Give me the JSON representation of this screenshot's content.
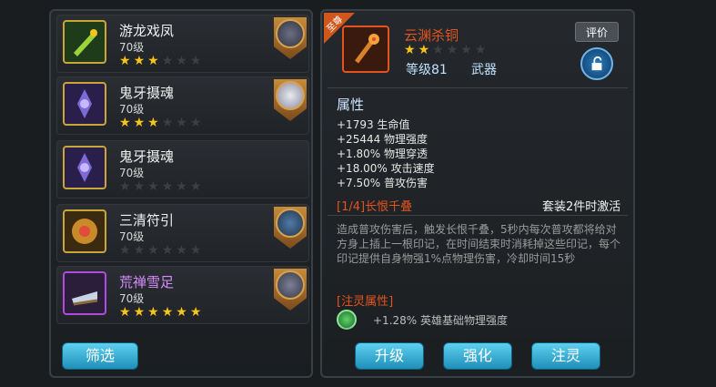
{
  "items": [
    {
      "name": "游龙戏凤",
      "level": "70级",
      "stars_filled": 3,
      "stars_total": 6,
      "name_color": "#f0f0f0"
    },
    {
      "name": "鬼牙摄魂",
      "level": "70级",
      "stars_filled": 3,
      "stars_total": 6,
      "name_color": "#f0f0f0"
    },
    {
      "name": "鬼牙摄魂",
      "level": "70级",
      "stars_filled": 0,
      "stars_total": 6,
      "name_color": "#f0f0f0"
    },
    {
      "name": "三清符引",
      "level": "70级",
      "stars_filled": 0,
      "stars_total": 6,
      "name_color": "#f0f0f0"
    },
    {
      "name": "荒禅雪足",
      "level": "70级",
      "stars_filled": 6,
      "stars_total": 6,
      "name_color": "#d68cff"
    }
  ],
  "filter_button": "筛选",
  "detail": {
    "corner_tag": "至尊",
    "title": "云渊杀铜",
    "stars_filled": 2,
    "stars_total": 6,
    "level": "等级81",
    "type": "武器",
    "review_button": "评价",
    "section_attr": "属性",
    "attributes": [
      "+1793 生命值",
      "+25444 物理强度",
      "+1.80% 物理穿透",
      "+18.00% 攻击速度",
      "+7.50% 普攻伤害"
    ],
    "set_name": "[1/4]长恨千叠",
    "set_note": "套装2件时激活",
    "set_desc": "造成普攻伤害后，触发长恨千叠，5秒内每次普攻都将给对方身上插上一根印记，在时间结束时消耗掉这些印记，每个印记提供自身物强1%点物理伤害，冷却时间15秒",
    "spirit_header": "[注灵属性]",
    "spirit_line": "+1.28% 英雄基础物理强度"
  },
  "buttons": {
    "upgrade": "升级",
    "enhance": "强化",
    "infuse": "注灵"
  },
  "colors": {
    "accent": "#e2541e",
    "star": "#f5c519",
    "button": "#2aa5d2"
  }
}
